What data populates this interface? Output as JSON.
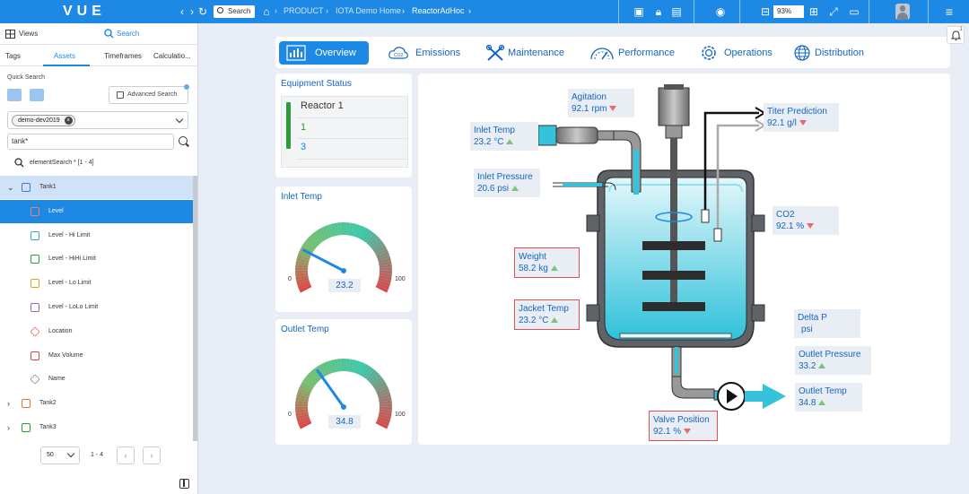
{
  "app": {
    "logo": "VUE",
    "search_label": "Search"
  },
  "breadcrumb": [
    "PRODUCT",
    "IOTA Demo Home",
    "ReactorAdHoc"
  ],
  "toolbar": {
    "zoom": "93%"
  },
  "left_panel": {
    "tabs_top": [
      "Views",
      "Search"
    ],
    "tabs_sub": [
      "Tags",
      "Assets",
      "Timeframes",
      "Calculatio..."
    ],
    "quick_search_label": "Quick Search",
    "advanced_search_label": "Advanced Search",
    "dataset_chip": "demo-dev2019",
    "search_text": "tank*",
    "result_label": "elementSearch * [1 - 4]",
    "tree": [
      {
        "label": "Tank1",
        "icon": "cube-icon",
        "color": "#3a7bd5"
      },
      {
        "label": "Level",
        "icon": "attribute-icon",
        "color": "#e08a6b"
      },
      {
        "label": "Level - Hi Limit",
        "icon": "attribute-icon",
        "color": "#3aa3b5"
      },
      {
        "label": "Level - HiHi Limit",
        "icon": "attribute-icon",
        "color": "#2e9b3a"
      },
      {
        "label": "Level - Lo Limit",
        "icon": "attribute-icon",
        "color": "#d9a521"
      },
      {
        "label": "Level - LoLo Limit",
        "icon": "attribute-icon",
        "color": "#8a6bbf"
      },
      {
        "label": "Location",
        "icon": "tag-icon",
        "color": "#e06262"
      },
      {
        "label": "Max Volume",
        "icon": "attribute-icon",
        "color": "#c05050"
      },
      {
        "label": "Name",
        "icon": "tag-icon",
        "color": "#888888"
      },
      {
        "label": "Tank2",
        "icon": "cube-icon",
        "color": "#e07a3a"
      },
      {
        "label": "Tank3",
        "icon": "cube-icon",
        "color": "#2e9b3a"
      }
    ],
    "page_size": "50",
    "page_range": "1 - 4"
  },
  "tabs": [
    "Overview",
    "Emissions",
    "Maintenance",
    "Performance",
    "Operations",
    "Distribution"
  ],
  "equipment_status": {
    "title": "Equipment Status",
    "name": "Reactor 1",
    "value1": "1",
    "value2": "3"
  },
  "gauges": [
    {
      "title": "Inlet Temp",
      "value": 23.2,
      "value_text": "23.2",
      "min": "0",
      "max": "100"
    },
    {
      "title": "Outlet Temp",
      "value": 34.8,
      "value_text": "34.8",
      "min": "0",
      "max": "100"
    }
  ],
  "diagram": {
    "agitation": {
      "label": "Agitation",
      "value": "92.1 rpm",
      "trend": "down"
    },
    "inlet_temp": {
      "label": "Inlet Temp",
      "value": "23.2 °C",
      "trend": "up"
    },
    "inlet_pressure": {
      "label": "Inlet Pressure",
      "value": "20.6 psi",
      "trend": "up"
    },
    "titer_prediction": {
      "label": "Titer Prediction",
      "value": "92.1 g/l",
      "trend": "down"
    },
    "co2": {
      "label": "CO2",
      "value": "92.1 %",
      "trend": "down"
    },
    "weight": {
      "label": "Weight",
      "value": "58.2 kg",
      "trend": "up"
    },
    "jacket_temp": {
      "label": "Jacket Temp",
      "value": "23.2 °C",
      "trend": "up"
    },
    "delta_p": {
      "label": "Delta P",
      "value": "psi"
    },
    "outlet_pressure": {
      "label": "Outlet Pressure",
      "value": "33.2",
      "trend": "up"
    },
    "outlet_temp": {
      "label": "Outlet Temp",
      "value": "34.8",
      "trend": "up"
    },
    "valve_position": {
      "label": "Valve Position",
      "value": "92.1 %",
      "trend": "down"
    }
  },
  "colors": {
    "accent": "#1e88e5",
    "status_green": "#2e9b3a",
    "liquid": "#35c3dc"
  }
}
